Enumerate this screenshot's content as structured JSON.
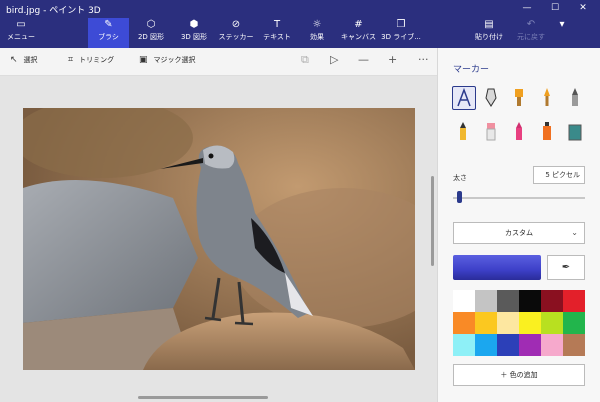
{
  "window": {
    "title": "bird.jpg - ペイント 3D",
    "controls": {
      "minimize": "—",
      "maximize": "☐",
      "close": "✕"
    }
  },
  "ribbon": {
    "menu": {
      "label": "メニュー",
      "icon": "folder-icon"
    },
    "tools": [
      {
        "label": "ブラシ",
        "icon": "brush-icon",
        "active": true
      },
      {
        "label": "2D 図形",
        "icon": "2d-shapes-icon"
      },
      {
        "label": "3D 図形",
        "icon": "3d-shapes-icon"
      },
      {
        "label": "ステッカー",
        "icon": "stickers-icon"
      },
      {
        "label": "テキスト",
        "icon": "text-icon"
      },
      {
        "label": "効果",
        "icon": "effects-icon"
      },
      {
        "label": "キャンバス",
        "icon": "canvas-icon"
      },
      {
        "label": "3D ライブ...",
        "icon": "3d-library-icon"
      }
    ],
    "paste": {
      "label": "貼り付け",
      "icon": "paste-icon"
    },
    "undo": {
      "label": "元に戻す",
      "icon": "undo-icon",
      "disabled": true
    },
    "more": "▾"
  },
  "toolbar2": {
    "select": "選択",
    "crop": "トリミング",
    "magic_select": "マジック選択",
    "zoom_out": "—",
    "zoom_in": "+",
    "more": "···"
  },
  "panel": {
    "title": "マーカー",
    "brushes": [
      {
        "name": "marker-brush",
        "selected": true
      },
      {
        "name": "calligraphy-pen"
      },
      {
        "name": "oil-brush"
      },
      {
        "name": "watercolor-brush"
      },
      {
        "name": "pixel-pen"
      },
      {
        "name": "pencil"
      },
      {
        "name": "eraser"
      },
      {
        "name": "crayon"
      },
      {
        "name": "spray-can"
      },
      {
        "name": "fill"
      }
    ],
    "size_label": "太さ",
    "size_value": "5 ピクセル",
    "size_fraction": 0.03,
    "finish_dropdown": "カスタム",
    "current_color": "#3d40c8",
    "palette": [
      "#ffffff",
      "#c4c4c4",
      "#5a5a5a",
      "#0a0a0a",
      "#8a1020",
      "#e3202a",
      "#f98a26",
      "#fbc820",
      "#fde7a0",
      "#faf020",
      "#b8e020",
      "#22b54c",
      "#8ef0f7",
      "#1ba7ef",
      "#2c40b8",
      "#a02cb4",
      "#f6a9cc",
      "#b57a56"
    ],
    "add_color": "色の追加"
  }
}
